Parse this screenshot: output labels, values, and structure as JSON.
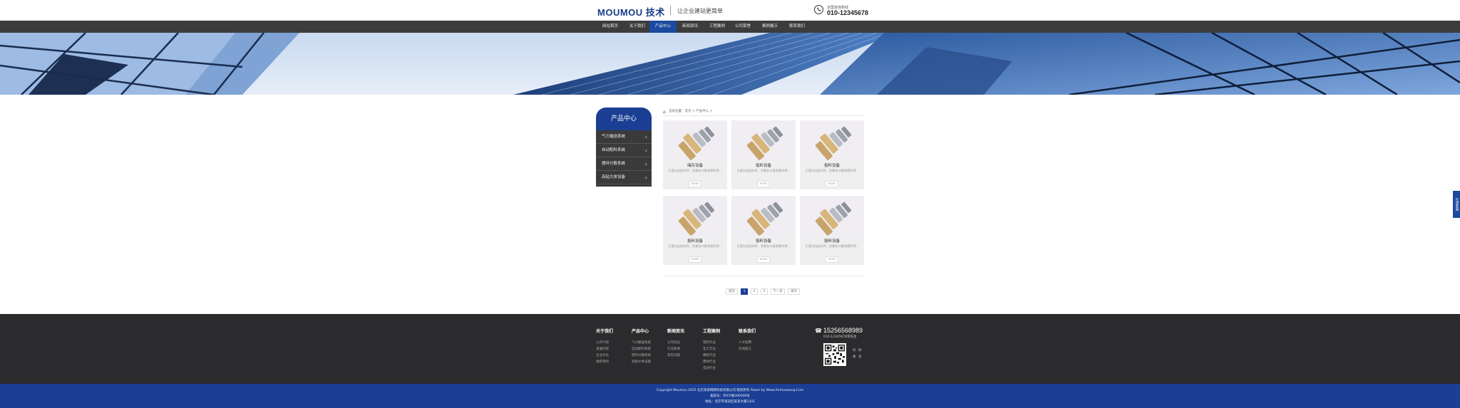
{
  "header": {
    "logo_text": "MOUMOU 技术",
    "slogan": "让企业建站更简单",
    "phone_label": "全国咨询热线",
    "phone_number": "010-12345678"
  },
  "nav": {
    "items": [
      "网站首页",
      "关于我们",
      "产品中心",
      "新闻资讯",
      "工程案例",
      "公司荣誉",
      "案例展示",
      "联系我们"
    ],
    "active_index": 2
  },
  "sidebar": {
    "title": "产品中心",
    "items": [
      "气力输送系统",
      "自动配料系统",
      "搅拌分散系统",
      "高粘大体设备"
    ]
  },
  "breadcrumb": {
    "text": "当前位置：首页 > 产品中心 >"
  },
  "products": [
    {
      "name": "储存设备",
      "desc": "主要包括配料秤，采集各计量装置所得...",
      "more": "MORE"
    },
    {
      "name": "投料设备",
      "desc": "主要包括配料秤，采集各计量装置所得...",
      "more": "MORE"
    },
    {
      "name": "投料设备",
      "desc": "主要包括配料秤，采集各计量装置所得...",
      "more": "MORE"
    },
    {
      "name": "投料设备",
      "desc": "主要包括配料秤，采集各计量装置所得...",
      "more": "MORE"
    },
    {
      "name": "投料设备",
      "desc": "主要包括配料秤，采集各计量装置所得...",
      "more": "MORE"
    },
    {
      "name": "投料设备",
      "desc": "主要包括配料秤，采集各计量装置所得...",
      "more": "MORE"
    }
  ],
  "pagination": {
    "prev": "首页",
    "current": "1",
    "pages": [
      "2",
      "3"
    ],
    "next": "下一页",
    "last": "末页"
  },
  "footer": {
    "columns": [
      {
        "title": "关于我们",
        "links": [
          "公司介绍",
          "发展历程",
          "企业文化",
          "组织架构"
        ]
      },
      {
        "title": "产品中心",
        "links": [
          "气力输送系统",
          "自动配料系统",
          "搅拌分散系统",
          "高粘大体设备"
        ]
      },
      {
        "title": "新闻资讯",
        "links": [
          "公司动态",
          "行业新闻",
          "常见问题"
        ]
      },
      {
        "title": "工程案例",
        "links": [
          "塑料行业",
          "化工行业",
          "橡胶行业",
          "建材行业",
          "电池行业"
        ]
      },
      {
        "title": "联系我们",
        "links": [
          "人才招聘",
          "在线留言"
        ]
      }
    ],
    "phone": "15256568989",
    "contact": "010-12345678李先生",
    "qr_labels": [
      "扫",
      "码",
      "关",
      "注"
    ],
    "copyright": "Copyright Moumou 2025 北京某某网络科技有限公司 版权所有 Power by Www.Xiuhuawang.Com",
    "icp": "备案号：京ICP备000000号",
    "address": "地址：北京市海淀区某某大厦1201"
  },
  "float_tab": "在线客服",
  "colors": {
    "brand_blue": "#1a3f94",
    "nav_bg": "#3c3c3c",
    "footer_bg": "#2b2b2d"
  }
}
